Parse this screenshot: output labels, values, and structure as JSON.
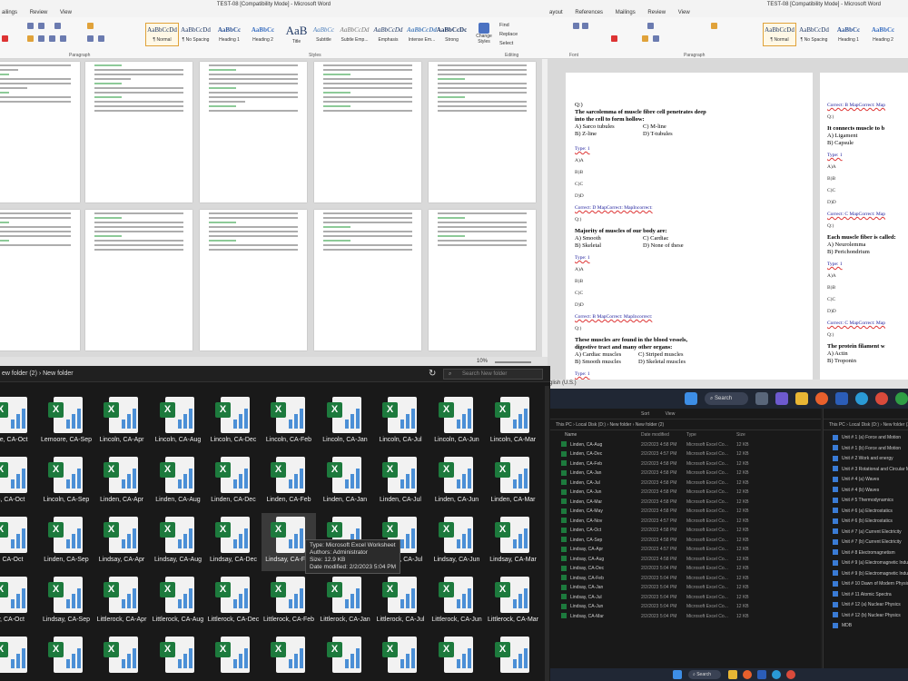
{
  "word_left": {
    "title": "TEST-08 [Compatibility Mode]  -  Microsoft Word",
    "tabs": [
      "ailings",
      "Review",
      "View"
    ],
    "groups": [
      "Font",
      "Paragraph",
      "Styles",
      "Editing"
    ],
    "styles": [
      {
        "preview": "AaBbCcDd",
        "name": "¶ Normal"
      },
      {
        "preview": "AaBbCcDd",
        "name": "¶ No Spacing"
      },
      {
        "preview": "AaBbCc",
        "name": "Heading 1"
      },
      {
        "preview": "AaBbCc",
        "name": "Heading 2"
      },
      {
        "preview": "AaB",
        "name": "Title"
      },
      {
        "preview": "AaBbCc",
        "name": "Subtitle"
      },
      {
        "preview": "AaBbCcDd",
        "name": "Subtle Emp..."
      },
      {
        "preview": "AaBbCcDd",
        "name": "Emphasis"
      },
      {
        "preview": "AaBbCcDd",
        "name": "Intense Em..."
      },
      {
        "preview": "AaBbCcDc",
        "name": "Strong"
      }
    ],
    "change_styles": "Change Styles",
    "editing": [
      "Find",
      "Replace",
      "Select"
    ],
    "zoom": "10%"
  },
  "word_right": {
    "title": "TEST-08 [Compatibility Mode]  -  Microsoft Word",
    "tabs": [
      "ayout",
      "References",
      "Mailings",
      "Review",
      "View"
    ],
    "groups": [
      "Font",
      "Paragraph"
    ],
    "styles": [
      {
        "preview": "AaBbCcDd",
        "name": "¶ Normal"
      },
      {
        "preview": "AaBbCcDd",
        "name": "¶ No Spacing"
      },
      {
        "preview": "AaBbCc",
        "name": "Heading 1"
      },
      {
        "preview": "AaBbCc",
        "name": "Heading 2"
      }
    ],
    "doc": {
      "q1": "The sarcolemma of muscle fibre cell penetrates deep into the cell to form hollow:",
      "q1_opts": [
        "A) Sarco tubules",
        "C) M-line",
        "B) Z-line",
        "D) T-tubules"
      ],
      "type": "Type: 1",
      "ans": [
        "A)A",
        "B)B",
        "C)C",
        "D)D"
      ],
      "correct": "Correct: D  MapCorrect:  MapIncorrect:",
      "q2_label": "Q:)",
      "q2": "Majority of muscles of our body are:",
      "q2_opts": [
        "A) Smooth",
        "C) Cardiac",
        "B) Skeletal",
        "D) None of these"
      ],
      "correct2": "Correct: B  MapCorrect:  MapIncorrect:",
      "q3": "These muscles are found in the blood vessels, digestive tract and many other organs:",
      "q3_opts": [
        "A) Cardiac muscles",
        "C) Striped muscles",
        "B) Smooth muscles",
        "D) Skeletal muscles"
      ],
      "r_correct": "Correct: B  MapCorrect:  Map",
      "r_q1": "It connects muscle to b",
      "r_q1_opts": [
        "A) Ligament",
        "B) Capsule"
      ],
      "r_correct2": "Correct: C  MapCorrect:  Map",
      "r_q2": "Each muscle fiber is called:",
      "r_q2_opts": [
        "A) Neurolemma",
        "B) Perichondrium"
      ],
      "r_correct3": "Correct: C  MapCorrect:  Map",
      "r_q3": "The protein filament w",
      "r_q3_opts": [
        "A) Actin",
        "B) Troponin"
      ]
    },
    "status": "glish (U.S.)"
  },
  "explorer": {
    "breadcrumb": "ew folder (2)  ›  New folder",
    "search_placeholder": "Search New folder",
    "files": [
      [
        "ore, CA-Oct",
        "Lemoore, CA-Sep",
        "Lincoln, CA-Apr",
        "Lincoln, CA-Aug",
        "Lincoln, CA-Dec",
        "Lincoln, CA-Feb",
        "Lincoln, CA-Jan",
        "Lincoln, CA-Jul",
        "Lincoln, CA-Jun",
        "Lincoln, CA-Mar"
      ],
      [
        "n, CA-Oct",
        "Lincoln, CA-Sep",
        "Linden, CA-Apr",
        "Linden, CA-Aug",
        "Linden, CA-Dec",
        "Linden, CA-Feb",
        "Linden, CA-Jan",
        "Linden, CA-Jul",
        "Linden, CA-Jun",
        "Linden, CA-Mar"
      ],
      [
        ", CA-Oct",
        "Linden, CA-Sep",
        "Lindsay, CA-Apr",
        "Lindsay, CA-Aug",
        "Lindsay, CA-Dec",
        "Lindsay, CA-Feb",
        "",
        "Lindsay, CA-Jul",
        "Lindsay, CA-Jun",
        "Lindsay, CA-Mar"
      ],
      [
        "y, CA-Oct",
        "Lindsay, CA-Sep",
        "Littlerock, CA-Apr",
        "Littlerock, CA-Aug",
        "Littlerock, CA-Dec",
        "Littlerock, CA-Feb",
        "Littlerock, CA-Jan",
        "Littlerock, CA-Jul",
        "Littlerock, CA-Jun",
        "Littlerock, CA-Mar"
      ],
      [
        "",
        "",
        "",
        "",
        "",
        "",
        "",
        "",
        "",
        ""
      ]
    ],
    "tooltip": [
      "Type: Microsoft Excel Worksheet",
      "Authors: Administrator",
      "Size: 12.9 KB",
      "Date modified: 2/2/2023 5:04 PM"
    ]
  },
  "taskbar": {
    "search": "Search"
  },
  "small_explorer": {
    "breadcrumb": "This PC  ›  Local Disk (D:)  ›  New folder  ›  New folder (2)",
    "sort": "Sort",
    "view": "View",
    "headers": [
      "Name",
      "Date modified",
      "Type",
      "Size"
    ],
    "rows": [
      [
        "Linden, CA-Aug",
        "2/2/2023 4:58 PM",
        "Microsoft Excel Co...",
        "12 KB"
      ],
      [
        "Linden, CA-Dec",
        "2/2/2023 4:57 PM",
        "Microsoft Excel Co...",
        "12 KB"
      ],
      [
        "Linden, CA-Feb",
        "2/2/2023 4:58 PM",
        "Microsoft Excel Co...",
        "12 KB"
      ],
      [
        "Linden, CA-Jan",
        "2/2/2023 4:58 PM",
        "Microsoft Excel Co...",
        "12 KB"
      ],
      [
        "Linden, CA-Jul",
        "2/2/2023 4:58 PM",
        "Microsoft Excel Co...",
        "12 KB"
      ],
      [
        "Linden, CA-Jun",
        "2/2/2023 4:58 PM",
        "Microsoft Excel Co...",
        "12 KB"
      ],
      [
        "Linden, CA-Mar",
        "2/2/2023 4:58 PM",
        "Microsoft Excel Co...",
        "12 KB"
      ],
      [
        "Linden, CA-May",
        "2/2/2023 4:58 PM",
        "Microsoft Excel Co...",
        "12 KB"
      ],
      [
        "Linden, CA-Nov",
        "2/2/2023 4:57 PM",
        "Microsoft Excel Co...",
        "12 KB"
      ],
      [
        "Linden, CA-Oct",
        "2/2/2023 4:58 PM",
        "Microsoft Excel Co...",
        "12 KB"
      ],
      [
        "Linden, CA-Sep",
        "2/2/2023 4:58 PM",
        "Microsoft Excel Co...",
        "12 KB"
      ],
      [
        "Lindsay, CA-Apr",
        "2/2/2023 4:57 PM",
        "Microsoft Excel Co...",
        "12 KB"
      ],
      [
        "Lindsay, CA-Aug",
        "2/2/2023 4:58 PM",
        "Microsoft Excel Co...",
        "12 KB"
      ],
      [
        "Lindsay, CA-Dec",
        "2/2/2023 5:04 PM",
        "Microsoft Excel Co...",
        "12 KB"
      ],
      [
        "Lindsay, CA-Feb",
        "2/2/2023 5:04 PM",
        "Microsoft Excel Co...",
        "12 KB"
      ],
      [
        "Lindsay, CA-Jan",
        "2/2/2023 5:04 PM",
        "Microsoft Excel Co...",
        "12 KB"
      ],
      [
        "Lindsay, CA-Jul",
        "2/2/2023 5:04 PM",
        "Microsoft Excel Co...",
        "12 KB"
      ],
      [
        "Lindsay, CA-Jun",
        "2/2/2023 5:04 PM",
        "Microsoft Excel Co...",
        "12 KB"
      ],
      [
        "Lindsay, CA-Mar",
        "2/2/2023 5:04 PM",
        "Microsoft Excel Co...",
        "12 KB"
      ]
    ]
  },
  "small_explorer2": {
    "breadcrumb": "This PC  ›  Local Disk (D:)  ›  New folder (2)",
    "rows": [
      "Unit # 1 (a) Force and Motion",
      "Unit # 1 (b) Force and Motion",
      "Unit # 2 Work and energy",
      "Unit # 3 Rotational and Circular Motion",
      "Unit # 4 (a) Waves",
      "Unit # 4 (b) Waves",
      "Unit # 5 Thermodynamics",
      "Unit # 6 (a) Electrostatics",
      "Unit # 6 (b) Electrostatics",
      "Unit # 7 (a) Current Electricity",
      "Unit # 7 (b) Current Electricity",
      "Unit # 8 Electromagnetism",
      "Unit # 9 (a) Electromagnetic Induction &...",
      "Unit # 9 (b) Electromagnetic Induction &...",
      "Unit # 10 Dawn of Modern Physics",
      "Unit # 11 Atomic Spectra",
      "Unit # 12 (a) Nuclear Physics",
      "Unit # 12 (b) Nuclear Physics",
      "MDB"
    ]
  }
}
